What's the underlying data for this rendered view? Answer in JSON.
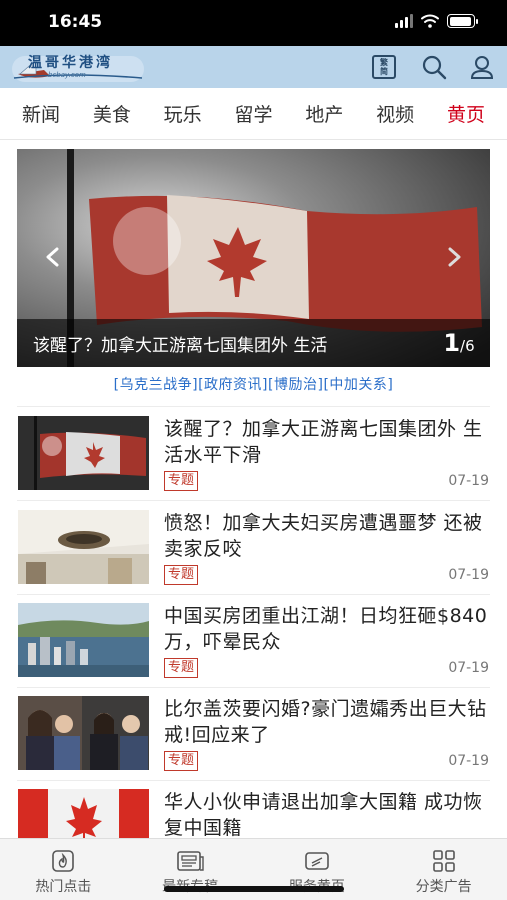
{
  "status_bar": {
    "time": "16:45",
    "battery_level": 0.95
  },
  "header": {
    "logo_text": "温哥华港湾",
    "logo_subtitle": "bcbay.com",
    "trad_simp_top": "繁",
    "trad_simp_bottom": "简"
  },
  "nav": {
    "tabs": [
      {
        "label": "新闻",
        "active": false
      },
      {
        "label": "美食",
        "active": false
      },
      {
        "label": "玩乐",
        "active": false
      },
      {
        "label": "留学",
        "active": false
      },
      {
        "label": "地产",
        "active": false
      },
      {
        "label": "视频",
        "active": false
      },
      {
        "label": "黄页",
        "active": true
      }
    ],
    "active_color": "#d0021b"
  },
  "carousel": {
    "caption": "该醒了？加拿大正游离七国集团外 生活",
    "current": "1",
    "total": "/6"
  },
  "tags": {
    "items": [
      "[乌克兰战争]",
      "[政府资讯]",
      "[博励治]",
      "[中加关系]"
    ]
  },
  "news": {
    "items": [
      {
        "title": "该醒了？加拿大正游离七国集团外 生活水平下滑",
        "badge": "专题",
        "date": "07-19",
        "thumb": "flag-dark"
      },
      {
        "title": "愤怒！加拿大夫妇买房遭遇噩梦 还被卖家反咬",
        "badge": "专题",
        "date": "07-19",
        "thumb": "damaged-ceiling"
      },
      {
        "title": "中国买房团重出江湖！日均狂砸$840万，吓晕民众",
        "badge": "专题",
        "date": "07-19",
        "thumb": "city-harbor"
      },
      {
        "title": "比尔盖茨要闪婚?豪门遗孀秀出巨大钻戒!回应来了",
        "badge": "专题",
        "date": "07-19",
        "thumb": "couple-photo"
      },
      {
        "title": "华人小伙申请退出加拿大国籍 成功恢复中国籍",
        "badge": "",
        "date": "",
        "thumb": "flag-bright"
      }
    ]
  },
  "bottom_nav": {
    "tabs": [
      {
        "label": "热门点击",
        "icon": "fire-icon"
      },
      {
        "label": "最新专稿",
        "icon": "news-icon"
      },
      {
        "label": "服务黄页",
        "icon": "ticket-icon"
      },
      {
        "label": "分类广告",
        "icon": "grid-icon"
      }
    ]
  }
}
